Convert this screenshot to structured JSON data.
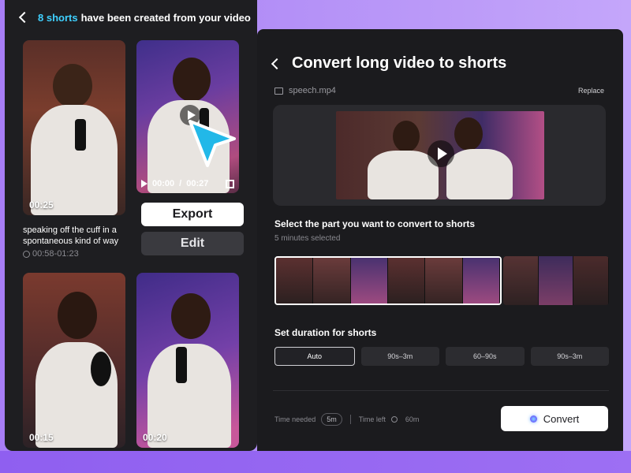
{
  "left_panel": {
    "header_count": "8 shorts",
    "header_text": "have been created from your video",
    "thumbnails": [
      {
        "duration": "00:25"
      },
      {
        "current_time": "00:00",
        "total_time": "00:27"
      },
      {
        "duration": "00:15"
      },
      {
        "duration": "00:20"
      }
    ],
    "description": "speaking off the cuff in a spontaneous kind of way",
    "time_range": "00:58-01:23",
    "export_label": "Export",
    "edit_label": "Edit"
  },
  "right_panel": {
    "title": "Convert long video to shorts",
    "file_name": "speech.mp4",
    "replace_label": "Replace",
    "select_title": "Select the part you want to convert to shorts",
    "selected_info": "5 minutes selected",
    "duration_title": "Set duration for shorts",
    "duration_options": [
      "Auto",
      "90s–3m",
      "60–90s",
      "90s–3m"
    ],
    "time_needed_label": "Time needed",
    "time_needed_value": "5m",
    "time_left_label": "Time left",
    "time_left_value": "60m",
    "convert_label": "Convert"
  },
  "colors": {
    "accent_cyan": "#3fd0ff",
    "cursor_cyan": "#22b8e8",
    "panel_bg": "#1e1e21",
    "background_purple": "#b592f7"
  },
  "icons": [
    "back-chevron-icon",
    "play-icon",
    "fullscreen-icon",
    "clock-icon",
    "film-icon",
    "cursor-arrow-icon",
    "convert-orb-icon"
  ]
}
